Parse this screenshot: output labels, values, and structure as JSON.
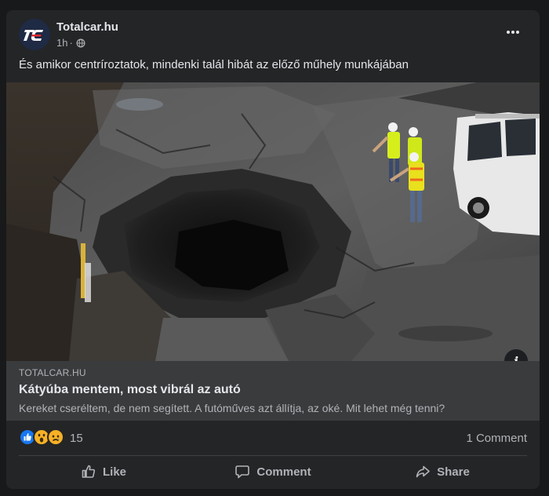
{
  "post": {
    "page_name": "Totalcar.hu",
    "timestamp": "1h",
    "separator": "·",
    "audience_icon": "globe-icon",
    "menu_icon": "more-horizontal-icon",
    "caption": "És amikor centríroztatok, mindenki talál hibát az előző műhely munkájában"
  },
  "avatar": {
    "logo_text": "tc",
    "colors": {
      "background": "#1f2a44",
      "letters": "#ffffff",
      "accent": "#e1272d"
    }
  },
  "link": {
    "domain": "TOTALCAR.HU",
    "title": "Kátyúba mentem, most vibrál az autó",
    "description": "Kereket cseréltem, de nem segített. A futóműves azt állítja, az oké. Mit lehet még tenni?",
    "info_icon": "info-icon"
  },
  "reactions": {
    "icons": [
      "like-reaction-icon",
      "wow-reaction-icon",
      "sad-reaction-icon"
    ],
    "count": "15",
    "comments": "1 Comment"
  },
  "actions": [
    {
      "label": "Like",
      "icon": "thumbs-up-icon"
    },
    {
      "label": "Comment",
      "icon": "comment-bubble-icon"
    },
    {
      "label": "Share",
      "icon": "share-arrow-icon"
    }
  ],
  "colors": {
    "page_bg": "#18191a",
    "card_bg": "#242526",
    "link_bg": "#3a3b3c",
    "primary_text": "#e4e6eb",
    "secondary_text": "#b0b3b8",
    "like_blue": "#1877f2",
    "reaction_yellow": "#f7b125"
  }
}
